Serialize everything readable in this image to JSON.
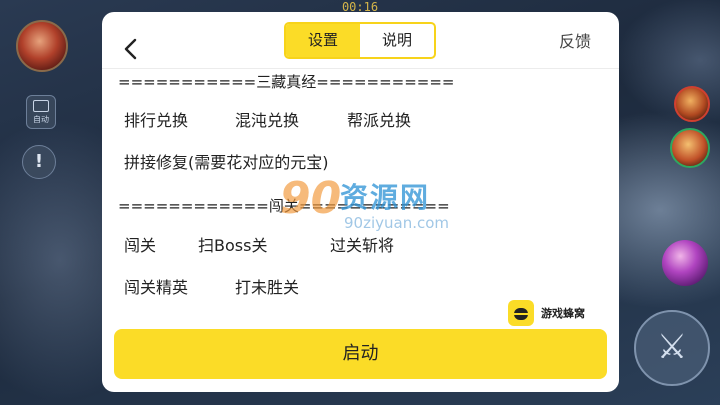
{
  "game": {
    "timer": "00:16",
    "auto_label": "自动",
    "alert_glyph": "!"
  },
  "dialog": {
    "tabs": [
      {
        "label": "设置",
        "active": true
      },
      {
        "label": "说明",
        "active": false
      }
    ],
    "feedback_label": "反馈",
    "sections": [
      {
        "header": "===========三藏真经===========",
        "rows": [
          [
            "排行兑换",
            "混沌兑换",
            "帮派兑换"
          ],
          [
            "拼接修复(需要花对应的元宝)"
          ]
        ]
      },
      {
        "header": "============闯关============",
        "rows": [
          [
            "闯关",
            "扫Boss关",
            "过关斩将"
          ],
          [
            "闯关精英",
            "打未胜关"
          ]
        ]
      }
    ],
    "brand_name": "游戏蜂窝",
    "start_label": "启动"
  },
  "watermark": {
    "logo_number": "90",
    "title": "资源网",
    "url": "90ziyuan.com"
  },
  "colors": {
    "accent_yellow": "#fbdc27",
    "tab_border": "#f7d31a",
    "watermark_orange": "#f39a3c",
    "watermark_blue": "#2f93d6"
  }
}
